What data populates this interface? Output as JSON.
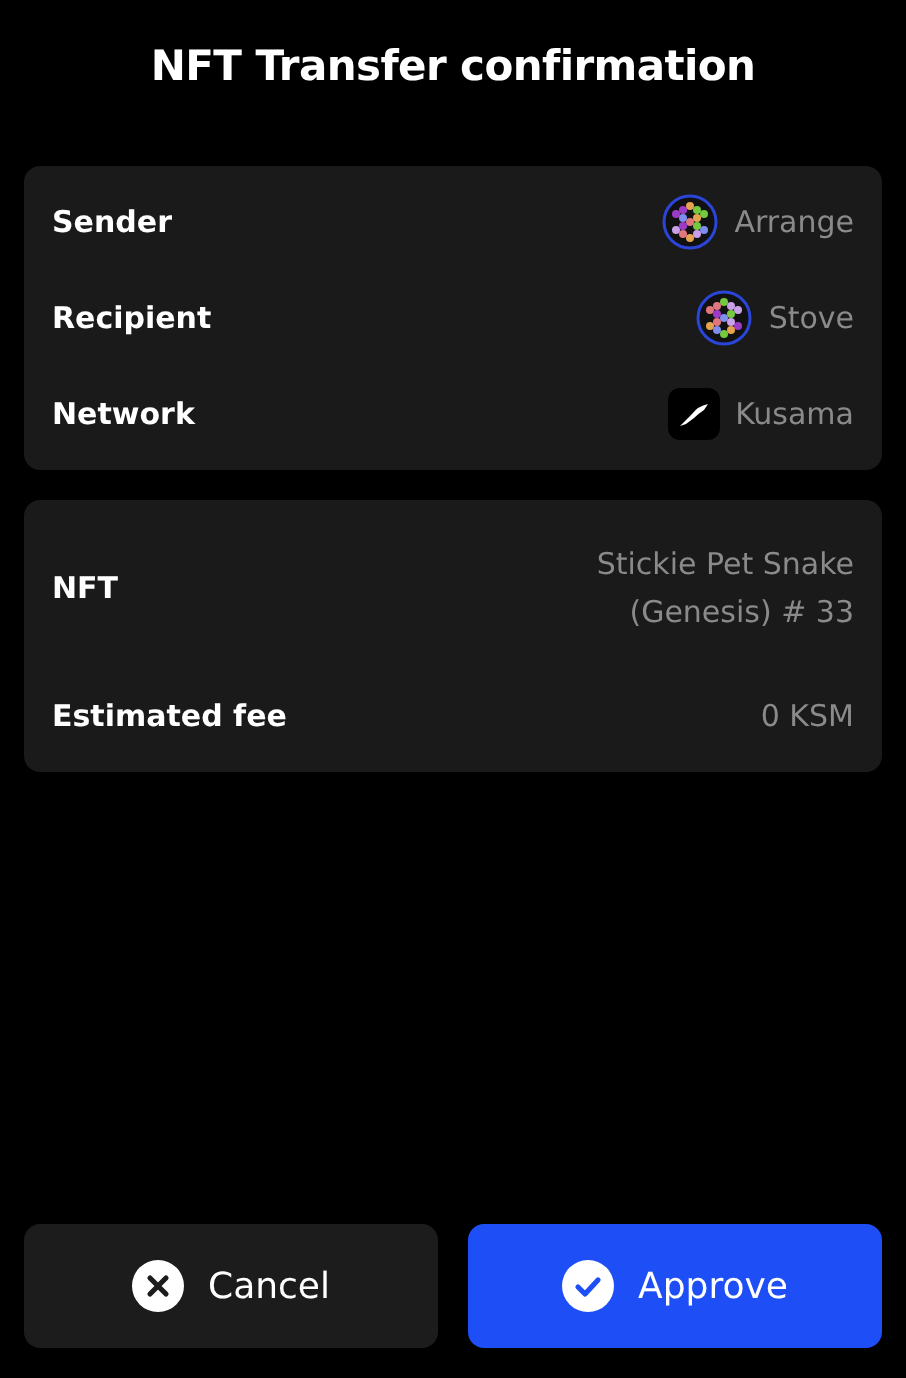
{
  "title": "NFT Transfer confirmation",
  "cards": [
    {
      "rows": [
        {
          "label": "Sender",
          "value": "Arrange",
          "kind": "account"
        },
        {
          "label": "Recipient",
          "value": "Stove",
          "kind": "account"
        },
        {
          "label": "Network",
          "value": "Kusama",
          "kind": "network"
        }
      ]
    },
    {
      "rows": [
        {
          "label": "NFT",
          "value": "Stickie Pet Snake (Genesis) # 33",
          "kind": "text"
        },
        {
          "label": "Estimated fee",
          "value": "0 KSM",
          "kind": "text"
        }
      ]
    }
  ],
  "buttons": [
    {
      "label": "Cancel",
      "kind": "cancel"
    },
    {
      "label": "Approve",
      "kind": "approve"
    }
  ]
}
